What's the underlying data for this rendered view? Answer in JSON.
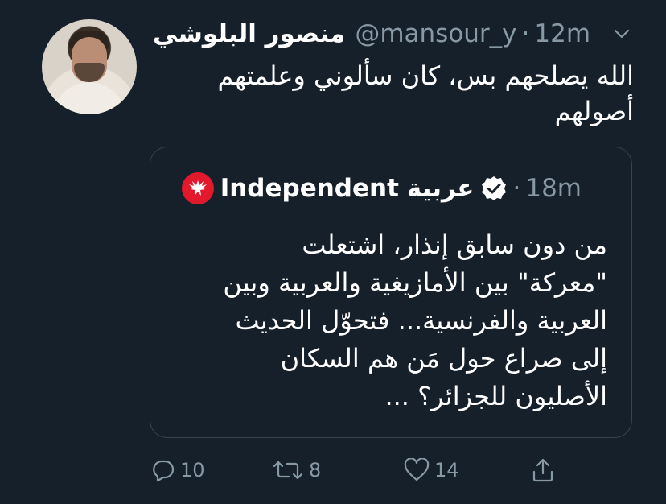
{
  "tweet": {
    "display_name": "منصور البلوشي",
    "handle": "@mansour_y",
    "separator": "·",
    "time": "12m",
    "text": "الله يصلحهم بس، كان سألوني وعلمتهم\nأصولهم"
  },
  "quote": {
    "account_name_en": "Independent",
    "account_name_ar": "عربية",
    "separator": "·",
    "time": "18m",
    "text": "من دون سابق إنذار، اشتعلت\n\"معركة\" بين الأمازيغية والعربية وبين\nالعربية والفرنسية... فتحوّل الحديث\nإلى صراع حول مَن هم السكان\nالأصليون للجزائر؟ ...",
    "logo_color": "#e2192c"
  },
  "actions": {
    "reply_count": "10",
    "retweet_count": "8",
    "like_count": "14"
  },
  "colors": {
    "background": "#15202b",
    "secondary_text": "#8899a6",
    "border": "#38444d",
    "verified": "#ffffff"
  }
}
